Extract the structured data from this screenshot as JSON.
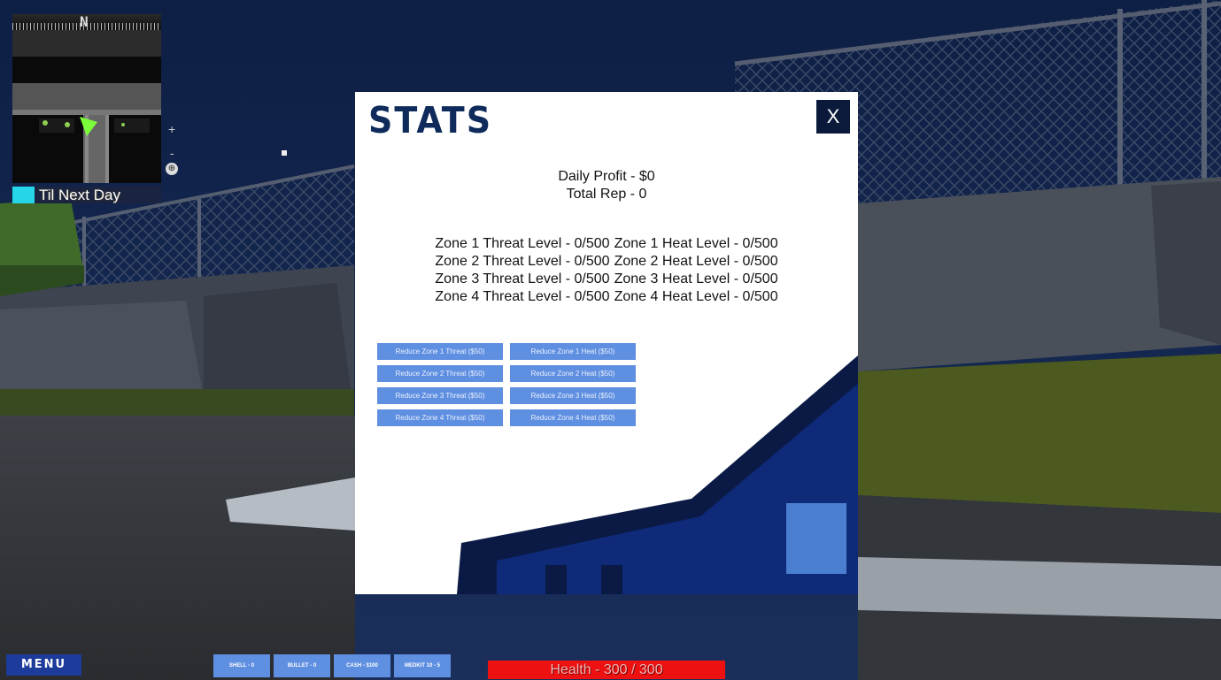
{
  "minimap": {
    "compass_label": "N",
    "zoom_in": "+",
    "zoom_out": "-",
    "reset_icon": "crosshair-icon",
    "day_label": "Til Next Day",
    "day_progress": 0.15
  },
  "stats": {
    "title": "STATS",
    "close_label": "X",
    "daily_profit": "Daily Profit - $0",
    "total_rep": "Total Rep - 0",
    "zones": [
      {
        "threat": "Zone 1 Threat Level - 0/500",
        "heat": "Zone 1 Heat Level - 0/500"
      },
      {
        "threat": "Zone 2 Threat Level - 0/500",
        "heat": "Zone 2 Heat Level - 0/500"
      },
      {
        "threat": "Zone 3 Threat Level - 0/500",
        "heat": "Zone 3 Heat Level - 0/500"
      },
      {
        "threat": "Zone 4 Threat Level - 0/500",
        "heat": "Zone 4 Heat Level - 0/500"
      }
    ],
    "buttons": [
      {
        "threat": "Reduce Zone 1 Threat ($50)",
        "heat": "Reduce Zone 1 Heat ($50)"
      },
      {
        "threat": "Reduce Zone 2 Threat ($50)",
        "heat": "Reduce Zone 2 Heat ($50)"
      },
      {
        "threat": "Reduce Zone 3 Threat ($50)",
        "heat": "Reduce Zone 3 Heat ($50)"
      },
      {
        "threat": "Reduce Zone 4 Threat ($50)",
        "heat": "Reduce Zone 4 Heat ($50)"
      }
    ]
  },
  "hud": {
    "menu_label": "MENU",
    "items": [
      "SHELL - 0",
      "BULLET - 0",
      "CASH - $100",
      "MEDKIT 10 - 5"
    ],
    "health_label": "Health - 300 / 300",
    "health_fraction": 1.0
  },
  "colors": {
    "accent": "#1c3b9b",
    "button": "#5f8fe0",
    "health": "#ee1111",
    "day_bar": "#26d6e8",
    "title": "#0f2b5c"
  }
}
